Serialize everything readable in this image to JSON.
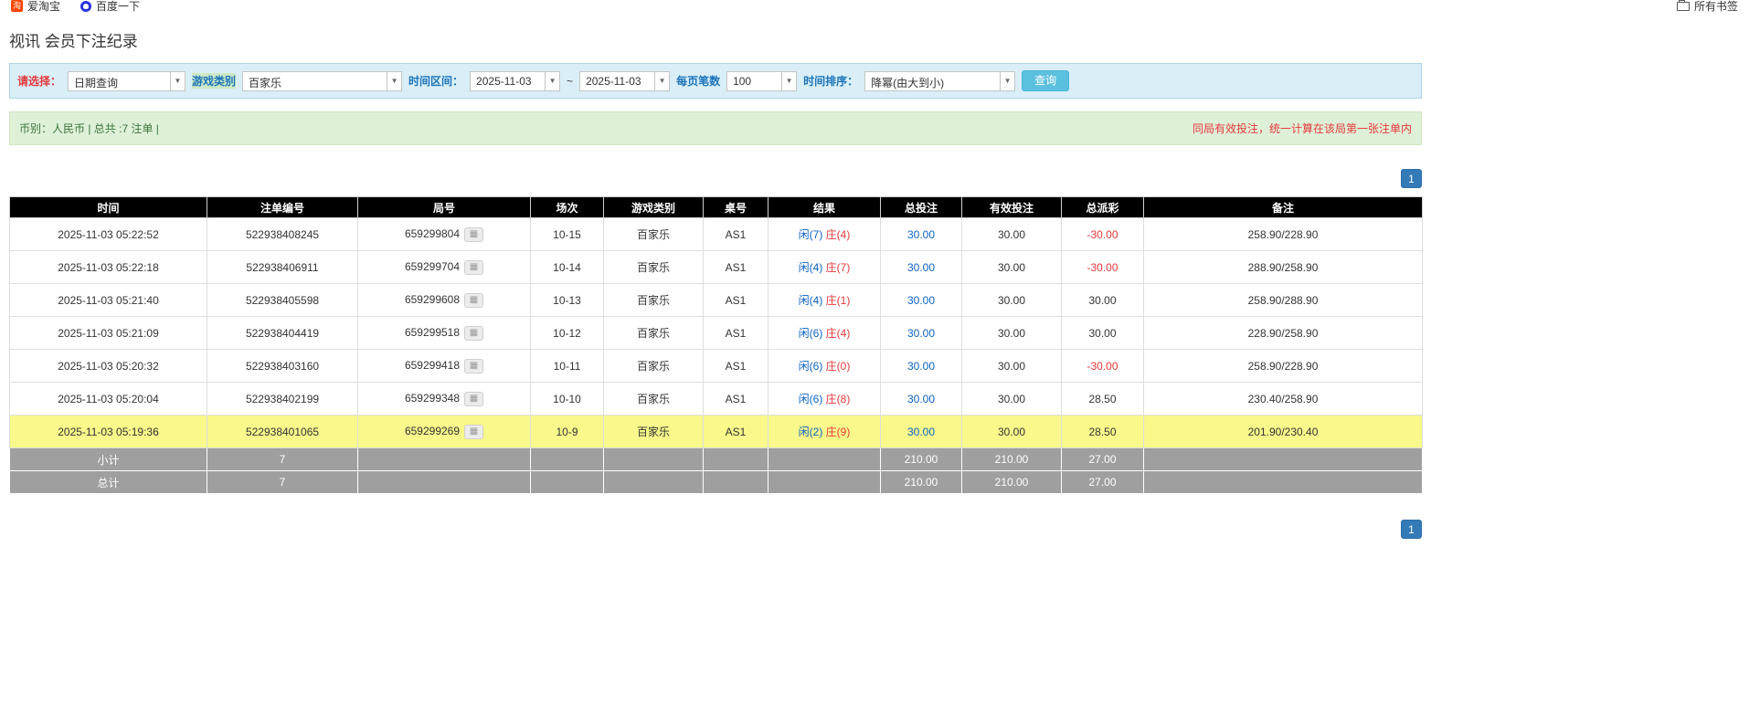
{
  "bookmarks": {
    "items": [
      {
        "label": "爱淘宝",
        "icon": "taobao-icon"
      },
      {
        "label": "百度一下",
        "icon": "baidu-icon"
      }
    ],
    "all_bookmarks": "所有书签"
  },
  "page": {
    "title": "视讯 会员下注纪录"
  },
  "filters": {
    "select_label": "请选择：",
    "select_value": "日期查询",
    "game_type_label": "游戏类别",
    "game_type_value": "百家乐",
    "time_range_label": "时间区间：",
    "date_from": "2025-11-03",
    "tilde": "~",
    "date_to": "2025-11-03",
    "page_size_label": "每页笔数",
    "page_size_value": "100",
    "sort_label": "时间排序：",
    "sort_value": "降幂(由大到小)",
    "search_button": "查询"
  },
  "summary": {
    "left": "币别：人民币 | 总共 :7 注单 |",
    "right": "同局有效投注，统一计算在该局第一张注单内"
  },
  "pagination": {
    "page": "1"
  },
  "table": {
    "headers": [
      "时间",
      "注单编号",
      "局号",
      "场次",
      "游戏类别",
      "桌号",
      "结果",
      "总投注",
      "有效投注",
      "总派彩",
      "备注"
    ],
    "rows": [
      {
        "time": "2025-11-03 05:22:52",
        "bet_id": "522938408245",
        "round": "659299804",
        "session": "10-15",
        "game": "百家乐",
        "table": "AS1",
        "player": "闲(7)",
        "banker": "庄(4)",
        "total_bet": "30.00",
        "valid_bet": "30.00",
        "payout": "-30.00",
        "note": "258.90/228.90",
        "highlight": false
      },
      {
        "time": "2025-11-03 05:22:18",
        "bet_id": "522938406911",
        "round": "659299704",
        "session": "10-14",
        "game": "百家乐",
        "table": "AS1",
        "player": "闲(4)",
        "banker": "庄(7)",
        "total_bet": "30.00",
        "valid_bet": "30.00",
        "payout": "-30.00",
        "note": "288.90/258.90",
        "highlight": false
      },
      {
        "time": "2025-11-03 05:21:40",
        "bet_id": "522938405598",
        "round": "659299608",
        "session": "10-13",
        "game": "百家乐",
        "table": "AS1",
        "player": "闲(4)",
        "banker": "庄(1)",
        "total_bet": "30.00",
        "valid_bet": "30.00",
        "payout": "30.00",
        "note": "258.90/288.90",
        "highlight": false
      },
      {
        "time": "2025-11-03 05:21:09",
        "bet_id": "522938404419",
        "round": "659299518",
        "session": "10-12",
        "game": "百家乐",
        "table": "AS1",
        "player": "闲(6)",
        "banker": "庄(4)",
        "total_bet": "30.00",
        "valid_bet": "30.00",
        "payout": "30.00",
        "note": "228.90/258.90",
        "highlight": false
      },
      {
        "time": "2025-11-03 05:20:32",
        "bet_id": "522938403160",
        "round": "659299418",
        "session": "10-11",
        "game": "百家乐",
        "table": "AS1",
        "player": "闲(6)",
        "banker": "庄(0)",
        "total_bet": "30.00",
        "valid_bet": "30.00",
        "payout": "-30.00",
        "note": "258.90/228.90",
        "highlight": false
      },
      {
        "time": "2025-11-03 05:20:04",
        "bet_id": "522938402199",
        "round": "659299348",
        "session": "10-10",
        "game": "百家乐",
        "table": "AS1",
        "player": "闲(6)",
        "banker": "庄(8)",
        "total_bet": "30.00",
        "valid_bet": "30.00",
        "payout": "28.50",
        "note": "230.40/258.90",
        "highlight": false
      },
      {
        "time": "2025-11-03 05:19:36",
        "bet_id": "522938401065",
        "round": "659299269",
        "session": "10-9",
        "game": "百家乐",
        "table": "AS1",
        "player": "闲(2)",
        "banker": "庄(9)",
        "total_bet": "30.00",
        "valid_bet": "30.00",
        "payout": "28.50",
        "note": "201.90/230.40",
        "highlight": true
      }
    ],
    "subtotal": {
      "label": "小计",
      "count": "7",
      "total_bet": "210.00",
      "valid_bet": "210.00",
      "payout": "27.00"
    },
    "total": {
      "label": "总计",
      "count": "7",
      "total_bet": "210.00",
      "valid_bet": "210.00",
      "payout": "27.00"
    }
  },
  "colors": {
    "accent_blue": "#337ab7",
    "filter_bg": "#d9eef7",
    "summary_bg": "#dff0d8",
    "highlight_row": "#f8f88b",
    "negative": "#e4393c",
    "player_blue": "#0b62c4",
    "banker_red": "#e4393c"
  }
}
